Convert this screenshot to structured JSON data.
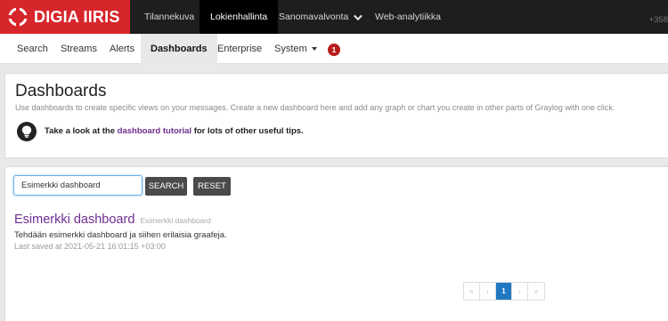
{
  "brand": {
    "name": "DIGIA IIRIS"
  },
  "topnav": {
    "items": [
      {
        "label": "Tilannekuva"
      },
      {
        "label": "Lokienhallinta",
        "active": true
      },
      {
        "label": "Sanomavalvonta",
        "dropdown": true
      },
      {
        "label": "Web-analytiikka"
      }
    ],
    "phone": "+358"
  },
  "subnav": {
    "items": [
      {
        "label": "Search"
      },
      {
        "label": "Streams"
      },
      {
        "label": "Alerts"
      },
      {
        "label": "Dashboards",
        "active": true
      },
      {
        "label": "Enterprise"
      },
      {
        "label": "System",
        "dropdown": true
      }
    ],
    "notification_count": "1"
  },
  "header": {
    "title": "Dashboards",
    "description": "Use dashboards to create specific views on your messages. Create a new dashboard here and add any graph or chart you create in other parts of Graylog with one click.",
    "tip_prefix": "Take a look at the ",
    "tip_link": "dashboard tutorial",
    "tip_suffix": " for lots of other useful tips."
  },
  "search": {
    "value": "Esimerkki dashboard",
    "search_label": "SEARCH",
    "reset_label": "RESET"
  },
  "dashboards": [
    {
      "title": "Esimerkki dashboard",
      "subtitle": "Esimerkki dashboard",
      "description": "Tehdään esimerkki dashboard ja siihen erilaisia graafeja.",
      "last_saved": "Last saved at 2021-05-21 16:01:15 +03:00"
    }
  ],
  "pagination": {
    "first": "«",
    "prev": "‹",
    "current": "1",
    "next": "›",
    "last": "»"
  },
  "colors": {
    "brand_red": "#d7262b",
    "topbar": "#1e1e1e",
    "link_purple": "#6f2d8f",
    "badge_red": "#b91c1c",
    "page_active": "#1f78c1"
  }
}
